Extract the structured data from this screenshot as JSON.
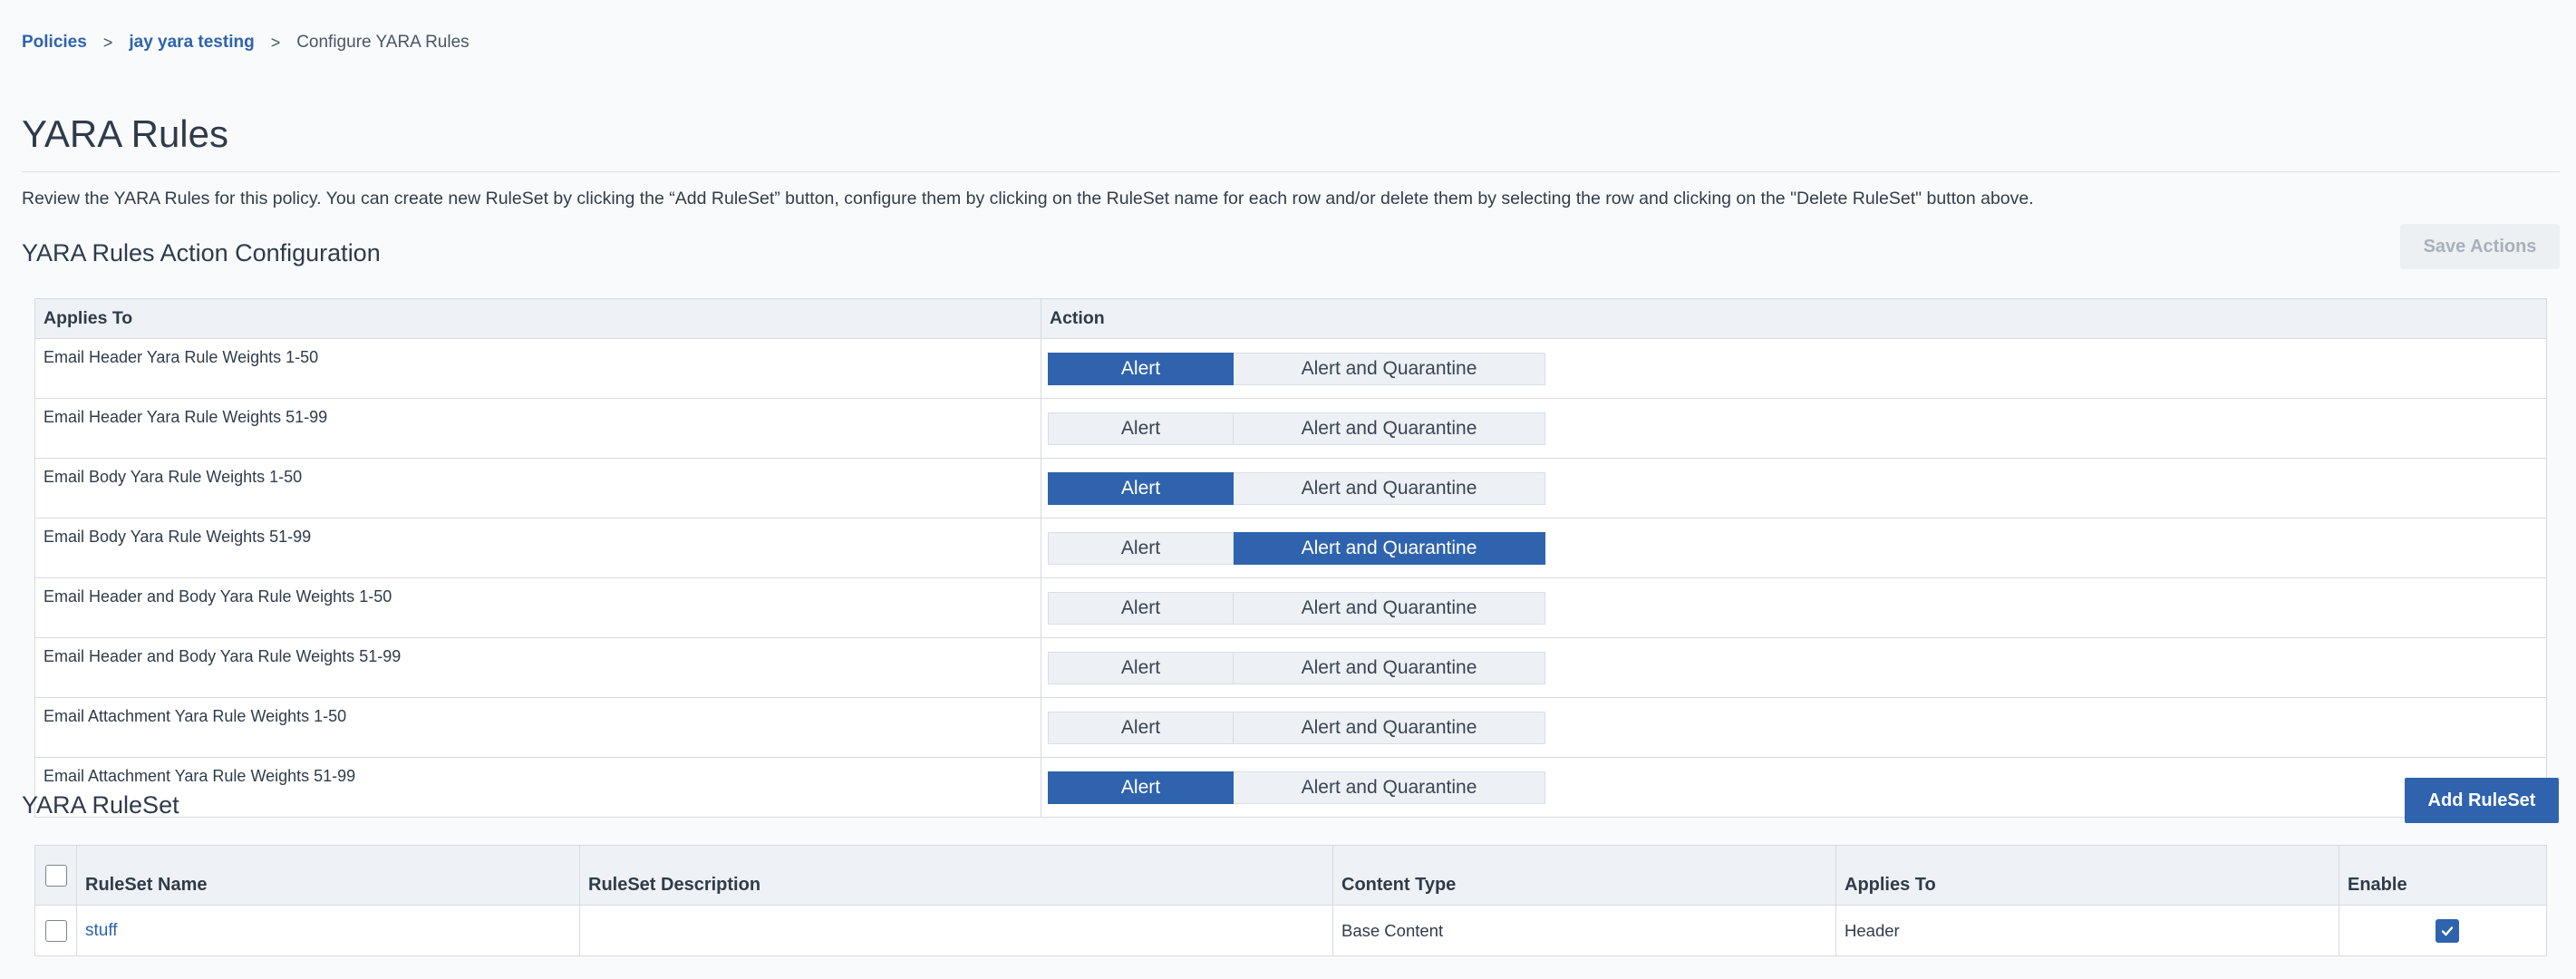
{
  "breadcrumb": {
    "items": [
      {
        "label": "Policies"
      },
      {
        "label": "jay yara testing"
      },
      {
        "label": "Configure YARA Rules"
      }
    ],
    "separator": ">"
  },
  "page": {
    "title": "YARA Rules",
    "description": "Review the YARA Rules for this policy. You can create new RuleSet by clicking the “Add RuleSet” button, configure them by clicking on the RuleSet name for each row and/or delete them by selecting the row and clicking on the \"Delete RuleSet\" button above."
  },
  "action_config": {
    "title": "YARA Rules Action Configuration",
    "save_label": "Save Actions",
    "columns": {
      "applies_to": "Applies To",
      "action": "Action"
    },
    "options": {
      "alert": "Alert",
      "alert_quarantine": "Alert and Quarantine"
    },
    "rows": [
      {
        "applies_to": "Email Header Yara Rule Weights 1-50",
        "selected": "alert"
      },
      {
        "applies_to": "Email Header Yara Rule Weights 51-99",
        "selected": "none"
      },
      {
        "applies_to": "Email Body Yara Rule Weights 1-50",
        "selected": "alert"
      },
      {
        "applies_to": "Email Body Yara Rule Weights 51-99",
        "selected": "alert_quarantine"
      },
      {
        "applies_to": "Email Header and Body Yara Rule Weights 1-50",
        "selected": "none"
      },
      {
        "applies_to": "Email Header and Body Yara Rule Weights 51-99",
        "selected": "none"
      },
      {
        "applies_to": "Email Attachment Yara Rule Weights 1-50",
        "selected": "none"
      },
      {
        "applies_to": "Email Attachment Yara Rule Weights 51-99",
        "selected": "alert"
      }
    ]
  },
  "ruleset": {
    "title": "YARA RuleSet",
    "add_label": "Add RuleSet",
    "columns": {
      "name": "RuleSet Name",
      "description": "RuleSet Description",
      "content_type": "Content Type",
      "applies_to": "Applies To",
      "enable": "Enable"
    },
    "rows": [
      {
        "name": "stuff",
        "description": "",
        "content_type": "Base Content",
        "applies_to": "Header",
        "enabled": true,
        "selected": false
      }
    ]
  },
  "colors": {
    "accent": "#2f63ad",
    "link": "#2e63ad",
    "header_bg": "#eef1f5"
  },
  "icons": {
    "enable_checked": "check-icon"
  }
}
